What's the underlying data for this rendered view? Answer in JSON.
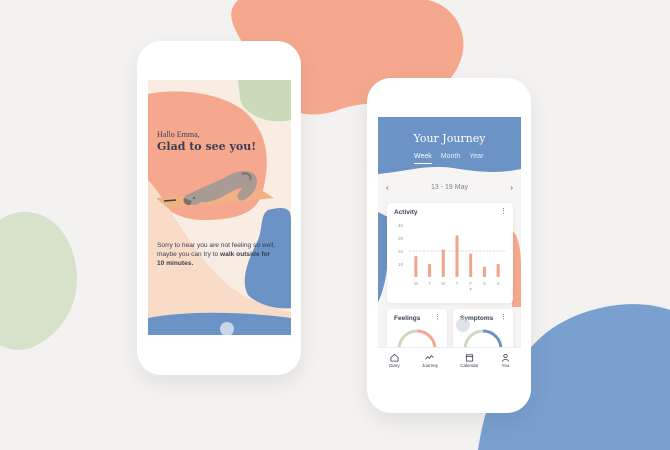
{
  "welcome": {
    "greeting_small": "Hallo Emma,",
    "greeting_big": "Glad to see you!",
    "message_prefix": "Sorry to hear you are not feeling so well, maybe you can try to ",
    "message_bold": "walk outside for 10 minutes."
  },
  "journey": {
    "title": "Your Journey",
    "tabs": [
      {
        "label": "Week",
        "active": true
      },
      {
        "label": "Month",
        "active": false
      },
      {
        "label": "Year",
        "active": false
      }
    ],
    "date_range": "13 - 19 May",
    "activity_card": {
      "title": "Activity",
      "menu_icon": "kebab-icon"
    },
    "feelings_card": {
      "title": "Feelings"
    },
    "symptoms_card": {
      "title": "Symptoms"
    },
    "nav": [
      {
        "label": "Diary",
        "icon": "home-icon"
      },
      {
        "label": "Journey",
        "icon": "trend-icon"
      },
      {
        "label": "Calendar",
        "icon": "calendar-icon"
      },
      {
        "label": "You",
        "icon": "user-icon"
      }
    ]
  },
  "chart_data": {
    "type": "bar",
    "title": "Activity",
    "categories": [
      "M",
      "T",
      "W",
      "T",
      "F",
      "S",
      "S"
    ],
    "values": [
      16,
      10,
      21,
      32,
      18,
      8,
      10
    ],
    "yticks": [
      "40",
      "30",
      "20",
      "10"
    ],
    "reference_line": 20,
    "ylim": [
      0,
      40
    ],
    "colors": {
      "bar": "#f0a58a",
      "reference": "#b0b0b0"
    }
  },
  "colors": {
    "salmon": "#f5a88e",
    "blue": "#6b93c5",
    "green": "#c9dbb8",
    "peach": "#f8dcc8"
  }
}
